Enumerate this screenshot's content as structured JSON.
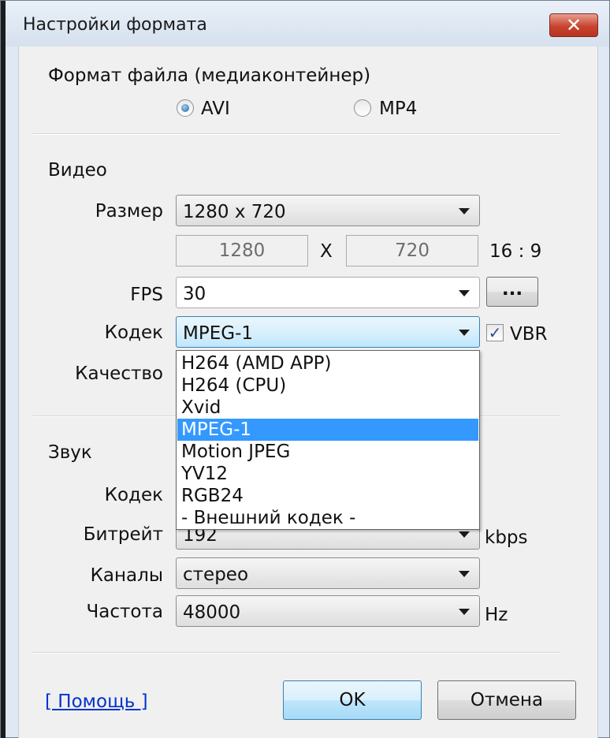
{
  "window": {
    "title": "Настройки формата",
    "close_glyph": "✕"
  },
  "format": {
    "label": "Формат файла (медиаконтейнер)",
    "options": [
      {
        "label": "AVI",
        "selected": true
      },
      {
        "label": "MP4",
        "selected": false
      }
    ]
  },
  "video": {
    "section_label": "Видео",
    "size_label": "Размер",
    "size_value": "1280 x 720",
    "width_value": "1280",
    "x_label": "X",
    "height_value": "720",
    "aspect": "16 : 9",
    "fps_label": "FPS",
    "fps_value": "30",
    "fps_more_label": "...",
    "codec_label": "Кодек",
    "codec_value": "MPEG-1",
    "vbr_label": "VBR",
    "vbr_checked": true,
    "vbr_check_glyph": "✓",
    "quality_label": "Качество"
  },
  "codec_dropdown": {
    "options": [
      {
        "label": "H264 (AMD APP)",
        "selected": false
      },
      {
        "label": "H264 (CPU)",
        "selected": false
      },
      {
        "label": "Xvid",
        "selected": false
      },
      {
        "label": "MPEG-1",
        "selected": true
      },
      {
        "label": "Motion JPEG",
        "selected": false
      },
      {
        "label": "YV12",
        "selected": false
      },
      {
        "label": "RGB24",
        "selected": false
      },
      {
        "label": "- Внешний кодек -",
        "selected": false
      }
    ]
  },
  "audio": {
    "section_label": "Звук",
    "codec_label": "Кодек",
    "bitrate_label": "Битрейт",
    "bitrate_value": "192",
    "bitrate_unit": "kbps",
    "channels_label": "Каналы",
    "channels_value": "стерео",
    "rate_label": "Частота",
    "rate_value": "48000",
    "rate_unit": "Hz"
  },
  "footer": {
    "help_link": "[ Помощь ]",
    "ok_label": "OK",
    "cancel_label": "Отмена"
  },
  "colors": {
    "selection": "#3399ff",
    "link": "#0033cc",
    "close_button": "#c8442f"
  }
}
